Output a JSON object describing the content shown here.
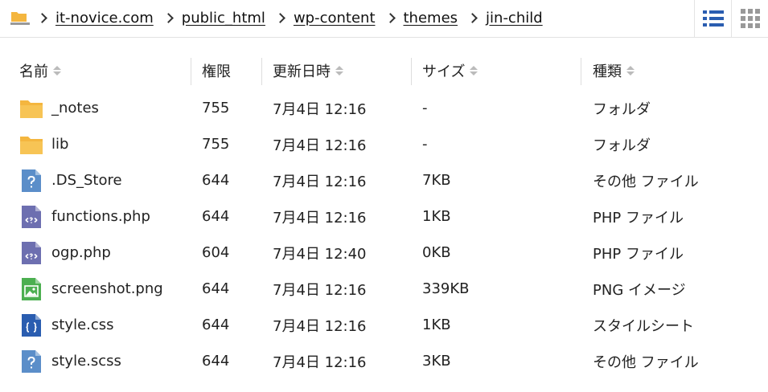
{
  "breadcrumb": [
    "it-novice.com",
    "public_html",
    "wp-content",
    "themes",
    "jin-child"
  ],
  "columns": {
    "name": "名前",
    "perm": "権限",
    "date": "更新日時",
    "size": "サイズ",
    "type": "種類"
  },
  "files": [
    {
      "name": "_notes",
      "perm": "755",
      "date": "7月4日 12:16",
      "size": "-",
      "type": "フォルダ",
      "icon": "folder-icon"
    },
    {
      "name": "lib",
      "perm": "755",
      "date": "7月4日 12:16",
      "size": "-",
      "type": "フォルダ",
      "icon": "folder-icon"
    },
    {
      "name": ".DS_Store",
      "perm": "644",
      "date": "7月4日 12:16",
      "size": "7KB",
      "type": "その他 ファイル",
      "icon": "unknown-file-icon"
    },
    {
      "name": "functions.php",
      "perm": "644",
      "date": "7月4日 12:16",
      "size": "1KB",
      "type": "PHP ファイル",
      "icon": "php-file-icon"
    },
    {
      "name": "ogp.php",
      "perm": "604",
      "date": "7月4日 12:40",
      "size": "0KB",
      "type": "PHP ファイル",
      "icon": "php-file-icon"
    },
    {
      "name": "screenshot.png",
      "perm": "644",
      "date": "7月4日 12:16",
      "size": "339KB",
      "type": "PNG イメージ",
      "icon": "image-file-icon"
    },
    {
      "name": "style.css",
      "perm": "644",
      "date": "7月4日 12:16",
      "size": "1KB",
      "type": "スタイルシート",
      "icon": "css-file-icon"
    },
    {
      "name": "style.scss",
      "perm": "644",
      "date": "7月4日 12:16",
      "size": "3KB",
      "type": "その他 ファイル",
      "icon": "unknown-file-icon"
    }
  ],
  "colors": {
    "folder": "#f4b63f",
    "unknown": "#5b8ec9",
    "php": "#6d6fb0",
    "image": "#4caf50",
    "css": "#2a5db0",
    "list_view_active": "#2a5db0",
    "grid_view": "#999999"
  }
}
